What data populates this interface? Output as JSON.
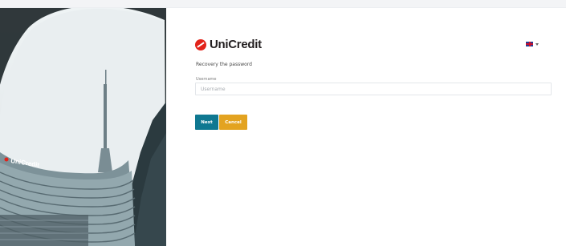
{
  "brand": {
    "name": "UniCredit",
    "accent_color": "#e2231a"
  },
  "language": {
    "selected_icon": "uk-flag-icon",
    "caret_icon": "chevron-down-icon"
  },
  "form": {
    "title": "Recovery the password",
    "username": {
      "label": "Username",
      "placeholder": "Username",
      "value": ""
    },
    "buttons": {
      "next": "Next",
      "cancel": "Cancel"
    }
  },
  "hero": {
    "building_sign": "UniCredit"
  },
  "colors": {
    "next_button": "#0f7891",
    "cancel_button": "#e3a320"
  }
}
